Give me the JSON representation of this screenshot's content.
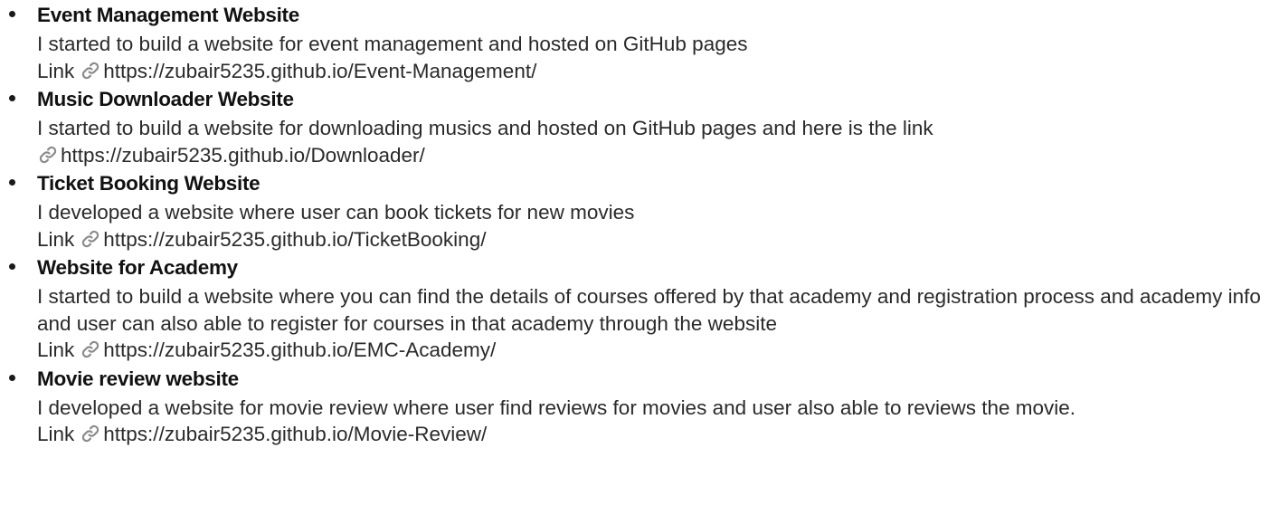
{
  "projects": [
    {
      "title": "Event Management Website",
      "description": "I started to build a website for event management and hosted on GitHub pages",
      "link_label": "Link",
      "url": "https://zubair5235.github.io/Event-Management/"
    },
    {
      "title": "Music Downloader Website",
      "description": "I started to build a website for downloading musics and hosted on GitHub pages and here is the link",
      "link_label": "",
      "url": "https://zubair5235.github.io/Downloader/"
    },
    {
      "title": "Ticket Booking Website",
      "description": "I developed a website where user can book tickets for new movies",
      "link_label": "Link",
      "url": "https://zubair5235.github.io/TicketBooking/"
    },
    {
      "title": "Website for Academy",
      "description": "I started to build a website where you can find the details of courses offered by that academy and registration process and academy info and user can also able to register for courses in that academy through the website",
      "link_label": "Link",
      "url": "https://zubair5235.github.io/EMC-Academy/"
    },
    {
      "title": "Movie review website",
      "description": "I developed a website for movie review where user find reviews for movies and user also able to reviews the movie.",
      "link_label": "Link",
      "url": "https://zubair5235.github.io/Movie-Review/"
    }
  ],
  "icons": {
    "link": "link-icon"
  },
  "colors": {
    "text": "#1a1a1a",
    "icon": "#8a8a8a"
  }
}
